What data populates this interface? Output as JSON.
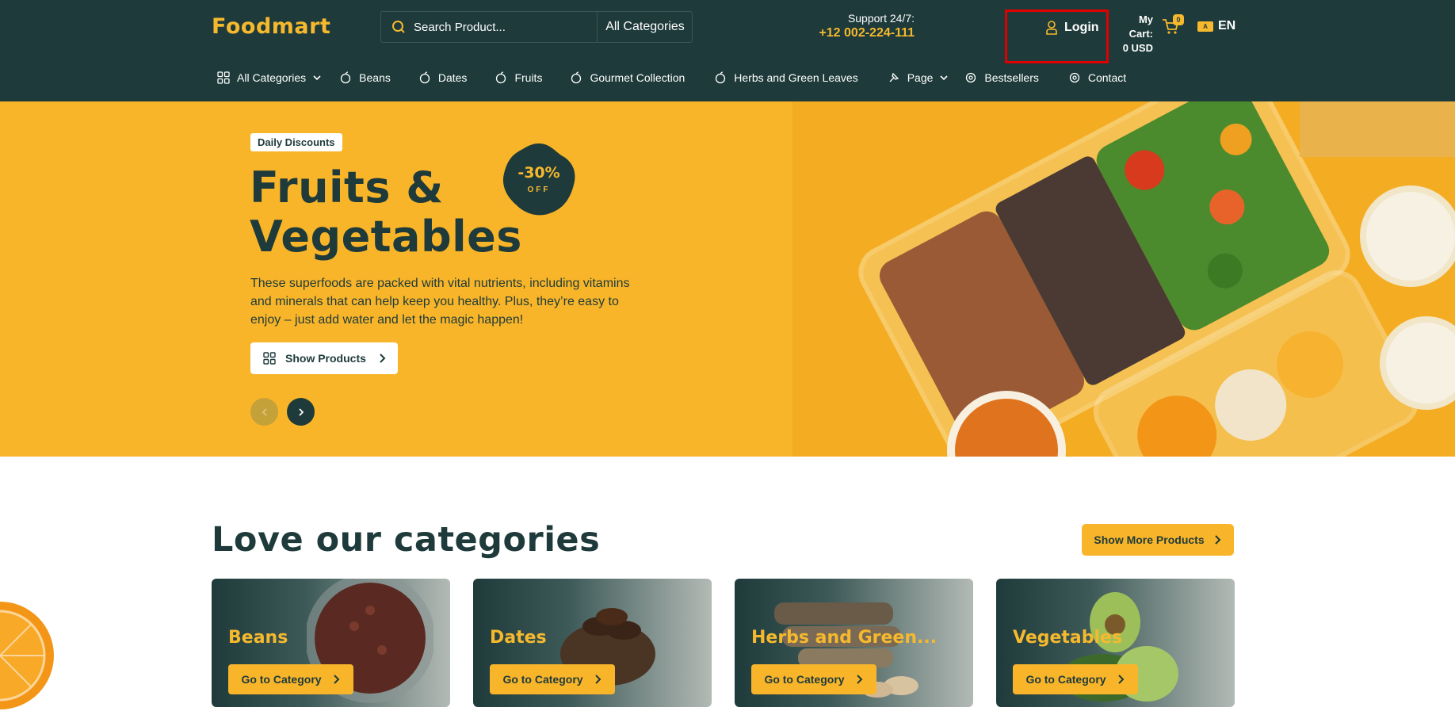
{
  "header": {
    "logo": "Foodmart",
    "search_placeholder": "Search Product...",
    "search_category": "All Categories",
    "support_label": "Support 24/7:",
    "support_phone": "+12 002-224-111",
    "login_label": "Login",
    "cart_label": "My Cart:",
    "cart_total": "0 USD",
    "cart_count": "0",
    "language": "EN"
  },
  "nav": {
    "items": [
      {
        "label": "All Categories",
        "icon": "grid-icon",
        "dropdown": true
      },
      {
        "label": "Beans",
        "icon": "apple-icon"
      },
      {
        "label": "Dates",
        "icon": "apple-icon"
      },
      {
        "label": "Fruits",
        "icon": "apple-icon"
      },
      {
        "label": "Gourmet Collection",
        "icon": "apple-icon"
      },
      {
        "label": "Herbs and Green Leaves",
        "icon": "apple-icon"
      },
      {
        "label": "Page",
        "icon": "pin-icon",
        "dropdown": true
      },
      {
        "label": "Bestsellers",
        "icon": "gear-icon"
      },
      {
        "label": "Contact",
        "icon": "gear-icon"
      }
    ]
  },
  "hero": {
    "badge": "Daily Discounts",
    "title_line1": "Fruits &",
    "title_line2": "Vegetables",
    "discount_value": "-30%",
    "discount_label": "OFF",
    "description": "These superfoods are packed with vital nutrients, including vitamins and minerals that can help keep you healthy. Plus, they’re easy to enjoy – just add water and let the magic happen!",
    "button_label": "Show Products"
  },
  "categories": {
    "title": "Love our categories",
    "more_button": "Show More Products",
    "cards": [
      {
        "name": "Beans",
        "button": "Go to Category"
      },
      {
        "name": "Dates",
        "button": "Go to Category"
      },
      {
        "name": "Herbs and Green...",
        "button": "Go to Category"
      },
      {
        "name": "Vegetables",
        "button": "Go to Category"
      }
    ]
  },
  "colors": {
    "header_bg": "#1e3a3a",
    "accent": "#f8b52a",
    "highlight_border": "#e00000"
  }
}
